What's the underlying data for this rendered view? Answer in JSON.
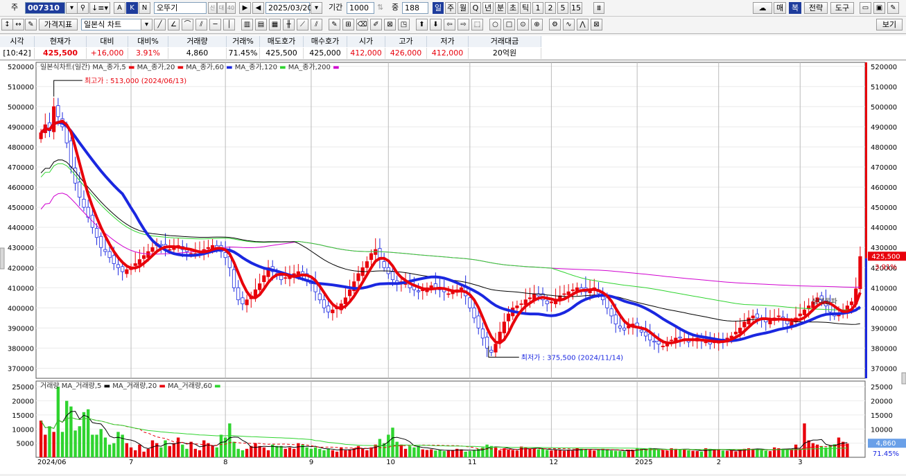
{
  "toolbar": {
    "code_label": "주",
    "stock_code": "007310",
    "stock_name": "오뚜기",
    "date": "2025/03/20",
    "period_label": "기간",
    "period_value": "1000",
    "count_label": "중",
    "count_value": "188",
    "timeframes": [
      "일",
      "주",
      "월",
      "Q",
      "년",
      "분",
      "초",
      "틱",
      "1",
      "2",
      "5",
      "15"
    ],
    "active_timeframe": "일",
    "right_buttons": [
      "매",
      "복",
      "전략",
      "도구"
    ],
    "mode_a": "A",
    "mode_k": "K",
    "mode_n": "N",
    "badge_1": "신",
    "badge_2": "대",
    "badge_3": "40"
  },
  "toolbar2": {
    "indicator_label": "가격지표",
    "chart_type": "일본식 차트",
    "view_label": "보기"
  },
  "quote": {
    "headers": [
      "시각",
      "현재가",
      "대비",
      "대비%",
      "거래량",
      "거래%",
      "매도호가",
      "매수호가",
      "시가",
      "고가",
      "저가",
      "거래대금"
    ],
    "values": [
      "[10:42]",
      "425,500",
      "+16,000",
      "3.91%",
      "4,860",
      "71.45%",
      "425,500",
      "425,000",
      "412,000",
      "426,000",
      "412,000",
      "20억원"
    ]
  },
  "legend": {
    "price_prefix": "일본식차트(일간)",
    "price_items": [
      {
        "label": "MA_종가,5",
        "color": "#e8000b"
      },
      {
        "label": "MA_종가,20",
        "color": "#e8000b"
      },
      {
        "label": "MA_종가,60",
        "color": "#1a27e0"
      },
      {
        "label": "MA_종가,120",
        "color": "#2fd42f"
      },
      {
        "label": "MA_종가,200",
        "color": "#d000d0"
      }
    ],
    "volume_prefix": "거래량",
    "volume_items": [
      {
        "label": "MA_거래량,5",
        "color": "#000000"
      },
      {
        "label": "MA_거래량,20",
        "color": "#e8000b"
      },
      {
        "label": "MA_거래량,60",
        "color": "#2fd42f"
      }
    ]
  },
  "annotations": {
    "high": "최고가 : 513,000 (2024/06/13)",
    "low": "최저가 : 375,500 (2024/11/14)",
    "current_price": "425,500",
    "current_pct": "3.91%",
    "current_volume": "4,860",
    "current_volume_pct": "71.45%",
    "breakout": "상대돌파"
  },
  "chart_data": {
    "type": "candlestick",
    "colors": {
      "up": "#e8000b",
      "down": "#1a27e0",
      "ma5": "#e8000b",
      "ma20": "#e8000b",
      "ma60": "#1a27e0",
      "ma120": "#2fd42f",
      "ma200": "#d000d0"
    },
    "y_ticks": [
      520000,
      510000,
      500000,
      490000,
      480000,
      470000,
      460000,
      450000,
      440000,
      430000,
      420000,
      410000,
      400000,
      390000,
      380000,
      370000
    ],
    "ylim": [
      365000,
      522000
    ],
    "vol_ticks": [
      25000,
      20000,
      15000,
      10000,
      5000
    ],
    "vol_ylim": [
      0,
      27000
    ],
    "x_labels": [
      "2024/06",
      "7",
      "8",
      "9",
      "10",
      "11",
      "12",
      "2025",
      "2",
      "3"
    ],
    "x_label_index": [
      0,
      21,
      43,
      63,
      81,
      100,
      119,
      139,
      158,
      177
    ],
    "closes": [
      487000,
      491000,
      488000,
      500000,
      495000,
      490000,
      482000,
      470000,
      462000,
      455000,
      450000,
      445000,
      440000,
      435000,
      430000,
      428000,
      425000,
      422000,
      420000,
      418000,
      419000,
      420000,
      422000,
      424000,
      426000,
      428000,
      430000,
      432000,
      431000,
      430000,
      429000,
      430000,
      431000,
      429000,
      428000,
      427000,
      427000,
      428000,
      429000,
      430000,
      431000,
      430000,
      428000,
      425000,
      420000,
      410000,
      404000,
      402000,
      404000,
      406000,
      409000,
      412000,
      416000,
      420000,
      418000,
      416000,
      414000,
      415000,
      416000,
      417000,
      418000,
      416000,
      414000,
      412000,
      408000,
      404000,
      400000,
      398000,
      399000,
      400000,
      402000,
      405000,
      409000,
      413000,
      417000,
      420000,
      423000,
      427000,
      429000,
      424000,
      420000,
      417000,
      414000,
      412000,
      413000,
      412000,
      410000,
      409000,
      408000,
      409000,
      410000,
      411000,
      410000,
      409000,
      408000,
      407000,
      408000,
      409000,
      410000,
      406000,
      400000,
      395000,
      390000,
      385000,
      380000,
      378000,
      382000,
      388000,
      393000,
      397000,
      400000,
      401000,
      402000,
      404000,
      405000,
      407000,
      406000,
      404000,
      402000,
      403000,
      404000,
      406000,
      407000,
      408000,
      409000,
      410000,
      409000,
      408000,
      409000,
      410000,
      407000,
      404000,
      400000,
      396000,
      392000,
      390000,
      389000,
      391000,
      392000,
      390000,
      388000,
      386000,
      384000,
      383000,
      382000,
      381000,
      383000,
      384000,
      385000,
      385000,
      384000,
      383000,
      384000,
      385000,
      384000,
      383000,
      382000,
      383000,
      384000,
      384000,
      385000,
      386000,
      388000,
      390000,
      393000,
      395000,
      396000,
      395000,
      394000,
      393000,
      394000,
      395000,
      396000,
      394000,
      392000,
      393000,
      395000,
      397000,
      399000,
      401000,
      403000,
      405000,
      404000,
      401000,
      398000,
      396000,
      397000,
      399000,
      401000,
      403000,
      409500,
      425500
    ],
    "volumes": [
      13000,
      8000,
      11000,
      9000,
      25000,
      9000,
      20000,
      18000,
      9500,
      11000,
      16000,
      17000,
      8000,
      8000,
      10000,
      7000,
      4500,
      5000,
      9000,
      8000,
      5000,
      3500,
      2500,
      4500,
      2000,
      3000,
      6000,
      5000,
      3500,
      6000,
      4000,
      5000,
      7000,
      4500,
      3000,
      5500,
      3000,
      2500,
      6000,
      5000,
      4000,
      3500,
      8000,
      7000,
      12000,
      5500,
      3000,
      2500,
      3000,
      4000,
      5000,
      4000,
      3500,
      2500,
      4500,
      4000,
      4000,
      3000,
      3500,
      3000,
      5000,
      4500,
      3500,
      3000,
      3500,
      3000,
      2500,
      3000,
      2500,
      2000,
      3500,
      2500,
      2800,
      3200,
      4000,
      3000,
      2500,
      3500,
      4500,
      6500,
      5000,
      8000,
      10500,
      5500,
      4500,
      3000,
      4000,
      3500,
      4000,
      2800,
      2600,
      2800,
      2400,
      2600,
      2200,
      2400,
      2600,
      3000,
      2800,
      2000,
      2200,
      2500,
      3000,
      3500,
      4500,
      4000,
      3500,
      2500,
      3200,
      2800,
      2600,
      2400,
      3800,
      3400,
      3200,
      3000,
      2800,
      3000,
      2600,
      2400,
      2700,
      2500,
      2300,
      2600,
      2400,
      3200,
      3000,
      2800,
      2600,
      2400,
      2800,
      3000,
      2600,
      2400,
      2300,
      2200,
      2100,
      2700,
      2500,
      3300,
      3000,
      2800,
      3300,
      3000,
      2800,
      2600,
      2400,
      3200,
      3000,
      2900,
      2800,
      2500,
      2300,
      2200,
      2000,
      3200,
      3000,
      2800,
      2600,
      2400,
      2300,
      2500,
      2100,
      2800,
      3000,
      3200,
      3000,
      2800,
      2600,
      2400,
      2200,
      3500,
      3200,
      3000,
      2800,
      2600,
      4500,
      3000,
      12000,
      6000,
      5000,
      4500,
      4000,
      3500,
      4200,
      4600,
      7000,
      5500,
      4860
    ]
  }
}
